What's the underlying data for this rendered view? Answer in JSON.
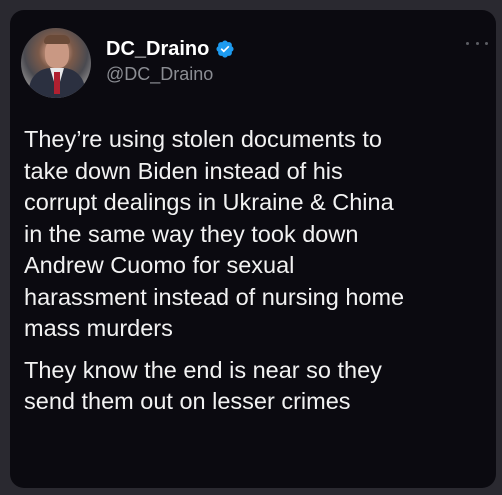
{
  "tweet": {
    "display_name": "DC_Draino",
    "handle": "@DC_Draino",
    "verified": true,
    "paragraphs": [
      "They’re using stolen documents to\ntake down Biden instead of his\ncorrupt dealings in Ukraine & China\nin the same way they took down\nAndrew Cuomo for sexual\nharassment instead of nursing home\nmass murders",
      "They know the end is near so they\nsend them out on lesser crimes"
    ]
  },
  "icons": {
    "verified": "verified-badge-icon",
    "more": "more-options-icon"
  },
  "colors": {
    "background": "#0b0a10",
    "text": "#f2f2f2",
    "handle": "#8b8d93",
    "verified_blue": "#1d9bf0"
  }
}
